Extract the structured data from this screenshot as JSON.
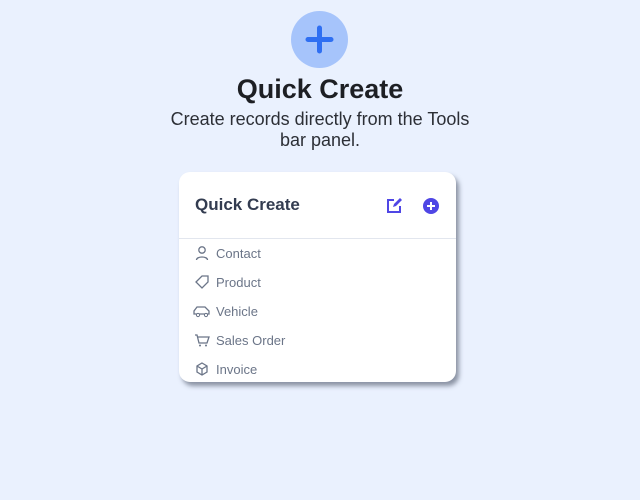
{
  "hero": {
    "title": "Quick Create",
    "subtitle": "Create records directly from the Tools bar panel."
  },
  "card": {
    "title": "Quick Create",
    "items": [
      {
        "label": "Contact",
        "icon": "user-icon"
      },
      {
        "label": "Product",
        "icon": "tag-icon"
      },
      {
        "label": "Vehicle",
        "icon": "car-icon"
      },
      {
        "label": "Sales Order",
        "icon": "cart-icon"
      },
      {
        "label": "Invoice",
        "icon": "box-icon"
      }
    ]
  },
  "colors": {
    "accent": "#4f46e5",
    "hero_bg": "#a6c4fb",
    "hero_plus": "#2f6ff2"
  }
}
